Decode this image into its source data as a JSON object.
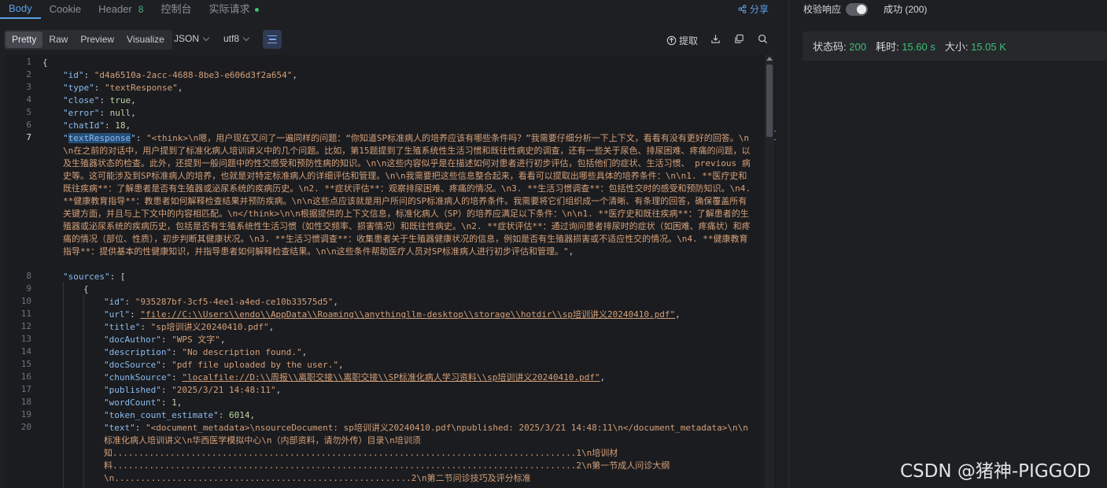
{
  "tabs": {
    "body": "Body",
    "cookie": "Cookie",
    "header": "Header",
    "header_count": "8",
    "console": "控制台",
    "actual_request": "实际请求",
    "share": "分享"
  },
  "toolbar": {
    "view_modes": [
      "Pretty",
      "Raw",
      "Preview",
      "Visualize"
    ],
    "format": "JSON",
    "encoding": "utf8",
    "extract": "提取"
  },
  "gutter": [
    "1",
    "2",
    "3",
    "4",
    "5",
    "6",
    "7",
    "8",
    "9",
    "10",
    "11",
    "12",
    "13",
    "14",
    "15",
    "16",
    "17",
    "18",
    "19",
    "20"
  ],
  "json": {
    "l1": "{",
    "id_key": "\"id\"",
    "id_val": "\"d4a6510a-2acc-4688-8be3-e606d3f2a654\"",
    "type_key": "\"type\"",
    "type_val": "\"textResponse\"",
    "close_key": "\"close\"",
    "close_val": "true",
    "error_key": "\"error\"",
    "error_val": "null",
    "chatid_key": "\"chatId\"",
    "chatid_val": "18",
    "tr_key_q": "\"",
    "tr_key_word": "textResponse",
    "tr_key_end": "\"",
    "text_response": "\"<think>\\n嗯，用户现在又问了一遍同样的问题：“你知道SP标准病人的培养应该有哪些条件吗？”我需要仔细分析一下上下文，看看有没有更好的回答。\\n\\n在之前的对话中，用户提到了标准化病人培训讲义中的几个问题。比如，第15题提到了生殖系统性生活习惯和既往性病史的调查，还有一些关于尿色、排尿困难、疼痛的问题，以及生殖器状态的检查。此外，还提到一般问题中的性交感受和预防性病的知识。\\n\\n这些内容似乎是在描述如何对患者进行初步评估，包括他们的症状、生活习惯、 previous 病史等。这可能涉及到SP标准病人的培养，也就是对特定标准病人的详细评估和管理。\\n\\n我需要把这些信息整合起来，看看可以提取出哪些具体的培养条件：\\n\\n1. **医疗史和既往疾病**：了解患者是否有生殖器或泌尿系统的疾病历史。\\n2. **症状评估**：观察排尿困难、疼痛的情况。\\n3. **生活习惯调查**：包括性交时的感受和预防知识。\\n4. **健康教育指导**：教患者如何解释检查结果并预防疾病。\\n\\n这些点应该就是用户所问的SP标准病人的培养条件。我需要将它们组织成一个清晰、有条理的回答，确保覆盖所有关键方面，并且与上下文中的内容相匹配。\\n</think>\\n\\n根据提供的上下文信息，标准化病人（SP）的培养应满足以下条件：\\n\\n1. **医疗史和既往疾病**：了解患者的生殖器或泌尿系统的疾病历史，包括是否有生殖系统性生活习惯（如性交频率、损害情况）和既往性病史。\\n2. **症状评估**：通过询问患者排尿时的症状（如困难、疼痛状）和疼痛的情况（部位、性质），初步判断其健康状况。\\n3. **生活习惯调查**：收集患者关于生殖器健康状况的信息，例如是否有生殖器损害或不适应性交的情况。\\n4. **健康教育指导**：提供基本的性健康知识，并指导患者如何解释检查结果。\\n\\n这些条件帮助医疗人员对SP标准病人进行初步评估和管理。\"",
    "sources_key": "\"sources\"",
    "src_id_key": "\"id\"",
    "src_id_val": "\"935287bf-3cf5-4ee1-a4ed-ce10b33575d5\"",
    "url_key": "\"url\"",
    "url_val": "\"file://C:\\\\Users\\\\endo\\\\AppData\\\\Roaming\\\\anythingllm-desktop\\\\storage\\\\hotdir\\\\sp培训讲义20240410.pdf\"",
    "title_key": "\"title\"",
    "title_val": "\"sp培训讲义20240410.pdf\"",
    "author_key": "\"docAuthor\"",
    "author_val": "\"WPS 文字\"",
    "desc_key": "\"description\"",
    "desc_val": "\"No description found.\"",
    "docsrc_key": "\"docSource\"",
    "docsrc_val": "\"pdf file uploaded by the user.\"",
    "chunk_key": "\"chunkSource\"",
    "chunk_val": "\"localfile://D:\\\\周报\\\\离职交接\\\\离职交接\\\\SP标准化病人学习资料\\\\sp培训讲义20240410.pdf\"",
    "pub_key": "\"published\"",
    "pub_val": "\"2025/3/21 14:48:11\"",
    "wc_key": "\"wordCount\"",
    "wc_val": "1",
    "tce_key": "\"token_count_estimate\"",
    "tce_val": "6014",
    "text_key": "\"text\"",
    "text_line1": "\"<document_metadata>\\nsourceDocument: sp培训讲义20240410.pdf\\npublished: 2025/3/21 14:48:11\\n</document_metadata>\\n\\n",
    "text_line2": "标准化病人培训讲义\\n华西医学模拟中心\\n（内部资料，请勿外传）目录\\n培训须",
    "text_line3": "知.........................................................................................1\\n培训材",
    "text_line4": "料.........................................................................................2\\n第一节成人问诊大纲",
    "text_line5": "\\n.........................................................2\\n第二节问诊技巧及评分标准"
  },
  "right": {
    "validate_label": "校验响应",
    "validate_on": true,
    "result": "成功 (200)",
    "status_label": "状态码:",
    "status_value": "200",
    "time_label": "耗时:",
    "time_value": "15.60 s",
    "size_label": "大小:",
    "size_value": "15.05 K"
  },
  "watermark": "CSDN @猪神-PIGGOD",
  "colors": {
    "accent": "#5ca0e6",
    "success": "#3fbf74",
    "json_key": "#8bbcf0",
    "json_string": "#d4a07a"
  }
}
